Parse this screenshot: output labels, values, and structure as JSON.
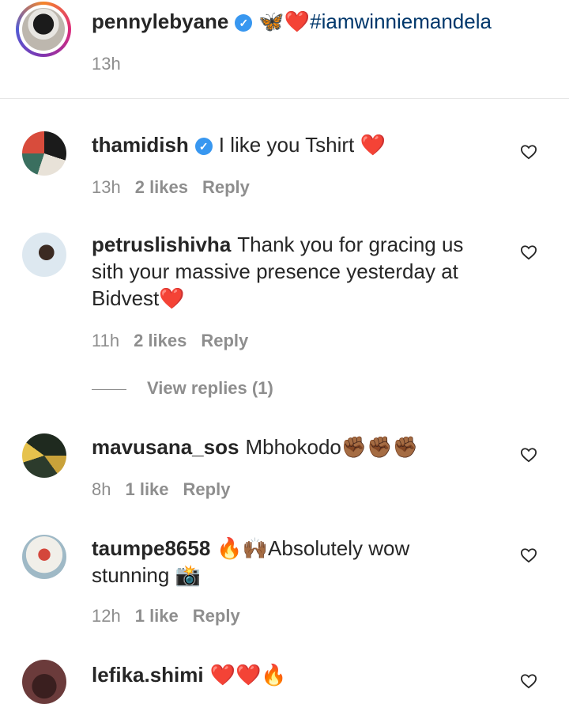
{
  "caption": {
    "username": "pennylebyane",
    "verified": true,
    "text_prefix": "🦋❤️",
    "hashtag": "#iamwinniemandela",
    "time": "13h"
  },
  "comments": [
    {
      "username": "thamidish",
      "verified": true,
      "text": "I like you Tshirt ❤️",
      "time": "13h",
      "likes": "2 likes",
      "reply_label": "Reply"
    },
    {
      "username": "petruslishivha",
      "verified": false,
      "text_line1": "Thank you for gracing us",
      "text_line2": "sith your massive presence yesterday at",
      "text_line3": "Bidvest❤️",
      "time": "11h",
      "likes": "2 likes",
      "reply_label": "Reply",
      "view_replies": "View replies (1)"
    },
    {
      "username": "mavusana_sos",
      "verified": false,
      "text": "Mbhokodo✊🏾✊🏾✊🏾",
      "time": "8h",
      "likes": "1 like",
      "reply_label": "Reply"
    },
    {
      "username": "taumpe8658",
      "verified": false,
      "text_line1": "🔥🙌🏾Absolutely wow",
      "text_line2": "stunning 📸",
      "time": "12h",
      "likes": "1 like",
      "reply_label": "Reply"
    },
    {
      "username": "lefika.shimi",
      "verified": false,
      "text": "❤️❤️🔥"
    }
  ],
  "icons": {
    "like": "heart-outline-icon",
    "verified": "verified-badge-icon"
  },
  "colors": {
    "verified": "#3897f0",
    "hashtag": "#00376b",
    "meta": "#8e8e8e",
    "text": "#262626"
  }
}
